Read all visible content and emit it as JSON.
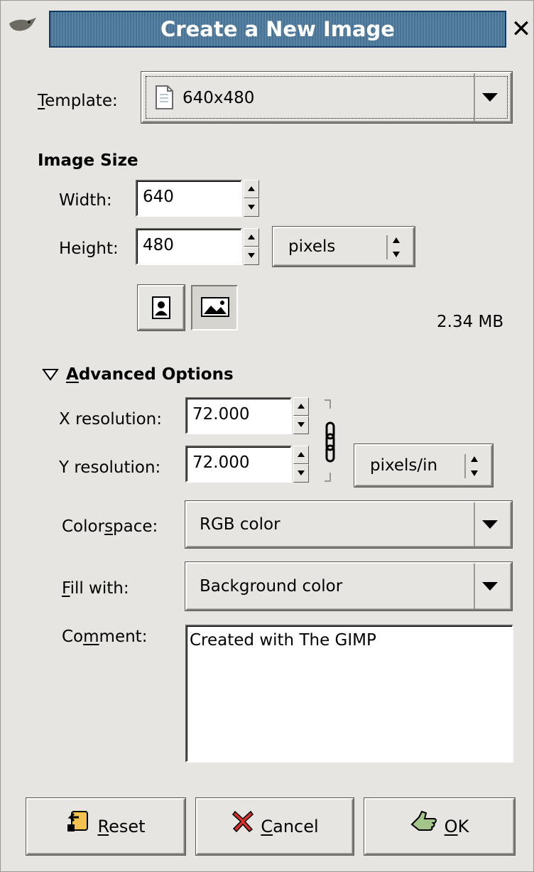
{
  "window": {
    "title": "Create a New Image",
    "close_glyph": "✕"
  },
  "template": {
    "label_mnemonic": "T",
    "label_rest": "emplate:",
    "value": "640x480"
  },
  "image_size": {
    "heading": "Image Size",
    "width_label": "Width:",
    "width_value": "640",
    "height_label": "Height:",
    "height_value": "480",
    "unit": "pixels",
    "memory": "2.34 MB"
  },
  "advanced": {
    "expander_mnemonic": "A",
    "expander_rest": "dvanced Options",
    "x_res_label": "X resolution:",
    "x_res_value": "72.000",
    "y_res_label": "Y resolution:",
    "y_res_value": "72.000",
    "res_unit": "pixels/in",
    "colorspace_pre": "Color",
    "colorspace_mnemonic": "s",
    "colorspace_post": "pace:",
    "colorspace_value": "RGB color",
    "fill_mnemonic": "F",
    "fill_rest": "ill with:",
    "fill_value": "Background color",
    "comment_pre": "Co",
    "comment_mnemonic": "m",
    "comment_post": "ment:",
    "comment_value": "Created with The GIMP"
  },
  "buttons": {
    "reset_mnemonic": "R",
    "reset_rest": "eset",
    "cancel_mnemonic": "C",
    "cancel_rest": "ancel",
    "ok_mnemonic": "O",
    "ok_rest": "K"
  },
  "icons": {
    "app": "gimp-wilber-icon",
    "template": "document-icon",
    "portrait": "portrait-icon",
    "landscape": "landscape-icon",
    "chain": "chain-link-icon",
    "reset": "reset-icon",
    "cancel": "cancel-x-icon",
    "ok": "ok-hand-icon"
  },
  "colors": {
    "titlebar": "#4f7a9c",
    "background": "#e6e5e1"
  }
}
